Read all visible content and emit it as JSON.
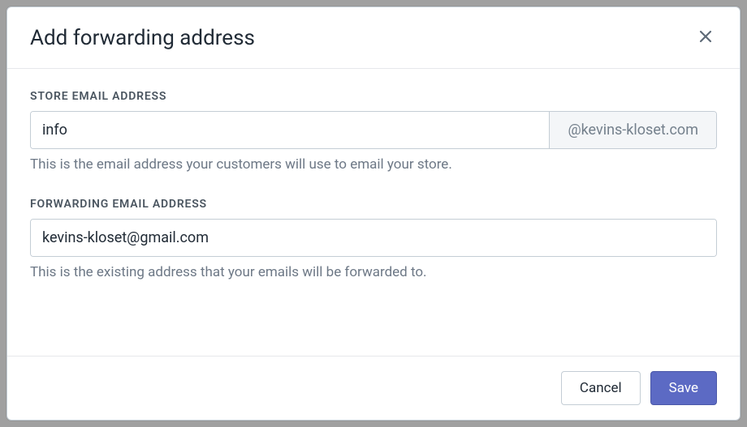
{
  "modal": {
    "title": "Add forwarding address",
    "close_icon": "close"
  },
  "store_email": {
    "label": "Store email address",
    "value": "info",
    "domain_suffix": "@kevins-kloset.com",
    "help": "This is the email address your customers will use to email your store."
  },
  "forwarding_email": {
    "label": "Forwarding email address",
    "value": "kevins-kloset@gmail.com",
    "help": "This is the existing address that your emails will be forwarded to."
  },
  "footer": {
    "cancel_label": "Cancel",
    "save_label": "Save"
  }
}
